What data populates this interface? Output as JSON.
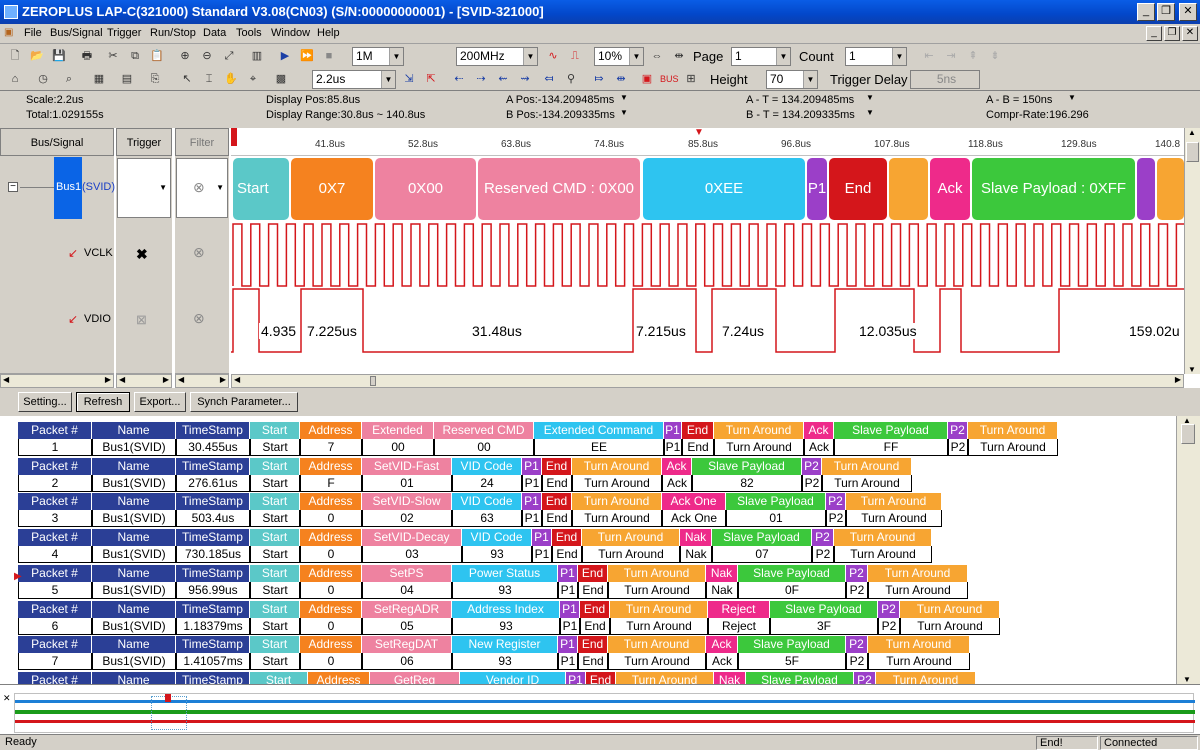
{
  "window": {
    "title": "ZEROPLUS LAP-C(321000) Standard V3.08(CN03) (S/N:00000000001) - [SVID-321000]"
  },
  "menu": [
    "File",
    "Bus/Signal",
    "Trigger",
    "Run/Stop",
    "Data",
    "Tools",
    "Window",
    "Help"
  ],
  "toolbar": {
    "memory": "1M",
    "rate": "200MHz",
    "zoom": "10%",
    "page_label": "Page",
    "page_value": "1",
    "count_label": "Count",
    "count_value": "1",
    "resolution": "2.2us",
    "height_label": "Height",
    "height_value": "70",
    "trigger_delay_label": "Trigger Delay",
    "trigger_delay_value": "5ns"
  },
  "info": {
    "scale": "Scale:2.2us",
    "total": "Total:1.029155s",
    "display_pos": "Display Pos:85.8us",
    "display_range": "Display Range:30.8us ~ 140.8us",
    "a_pos": "A Pos:-134.209485ms",
    "b_pos": "B Pos:-134.209335ms",
    "a_t": "A - T = 134.209485ms",
    "b_t": "B - T = 134.209335ms",
    "a_b": "A - B = 150ns",
    "compr": "Compr-Rate:196.296"
  },
  "wave": {
    "headers": {
      "bus": "Bus/Signal",
      "trigger": "Trigger",
      "filter": "Filter"
    },
    "bus_name": "Bus1",
    "bus_tag": "(SVID)",
    "signals": [
      "VCLK",
      "VDIO"
    ],
    "ticks": [
      "41.8us",
      "52.8us",
      "63.8us",
      "74.8us",
      "85.8us",
      "96.8us",
      "107.8us",
      "118.8us",
      "129.8us",
      "140.8"
    ],
    "segments": [
      {
        "label": "Start",
        "color": "#5bc8c8"
      },
      {
        "label": "0X7",
        "color": "#f5821f"
      },
      {
        "label": "0X00",
        "color": "#ee82a0"
      },
      {
        "label": "Reserved CMD : 0X00",
        "color": "#ee82a0"
      },
      {
        "label": "0XEE",
        "color": "#2ec4f0"
      },
      {
        "label": "P1",
        "color": "#9b3fc8"
      },
      {
        "label": "End",
        "color": "#d4161b"
      },
      {
        "label": "",
        "color": "#f7a532"
      },
      {
        "label": "Ack",
        "color": "#ee2a8a"
      },
      {
        "label": "Slave Payload : 0XFF",
        "color": "#3cc83c"
      },
      {
        "label": "",
        "color": "#9b3fc8"
      },
      {
        "label": "",
        "color": "#f7a532"
      }
    ],
    "timings": [
      "4.935",
      "7.225us",
      "31.48us",
      "7.215us",
      "7.24us",
      "12.035us",
      "159.02u"
    ]
  },
  "buttons": {
    "setting": "Setting...",
    "refresh": "Refresh",
    "export": "Export...",
    "sync": "Synch Parameter..."
  },
  "packets": [
    {
      "cells": [
        [
          "Packet #",
          "1"
        ],
        [
          "Name",
          "Bus1(SVID)"
        ],
        [
          "TimeStamp",
          "30.455us"
        ],
        [
          "Start",
          "Start"
        ],
        [
          "Address",
          "7"
        ],
        [
          "Extended",
          "00"
        ],
        [
          "Reserved CMD",
          "00"
        ],
        [
          "Extended Command",
          "EE"
        ],
        [
          "P1",
          "P1"
        ],
        [
          "End",
          "End"
        ],
        [
          "Turn Around",
          "Turn Around"
        ],
        [
          "Ack",
          "Ack"
        ],
        [
          "Slave Payload",
          "FF"
        ],
        [
          "P2",
          "P2"
        ],
        [
          "Turn Around",
          "Turn Around"
        ]
      ]
    },
    {
      "cells": [
        [
          "Packet #",
          "2"
        ],
        [
          "Name",
          "Bus1(SVID)"
        ],
        [
          "TimeStamp",
          "276.61us"
        ],
        [
          "Start",
          "Start"
        ],
        [
          "Address",
          "F"
        ],
        [
          "SetVID-Fast",
          "01"
        ],
        [
          "VID Code",
          "24"
        ],
        [
          "P1",
          "P1"
        ],
        [
          "End",
          "End"
        ],
        [
          "Turn Around",
          "Turn Around"
        ],
        [
          "Ack",
          "Ack"
        ],
        [
          "Slave Payload",
          "82"
        ],
        [
          "P2",
          "P2"
        ],
        [
          "Turn Around",
          "Turn Around"
        ]
      ]
    },
    {
      "cells": [
        [
          "Packet #",
          "3"
        ],
        [
          "Name",
          "Bus1(SVID)"
        ],
        [
          "TimeStamp",
          "503.4us"
        ],
        [
          "Start",
          "Start"
        ],
        [
          "Address",
          "0"
        ],
        [
          "SetVID-Slow",
          "02"
        ],
        [
          "VID Code",
          "63"
        ],
        [
          "P1",
          "P1"
        ],
        [
          "End",
          "End"
        ],
        [
          "Turn Around",
          "Turn Around"
        ],
        [
          "Ack One",
          "Ack One"
        ],
        [
          "Slave Payload",
          "01"
        ],
        [
          "P2",
          "P2"
        ],
        [
          "Turn Around",
          "Turn Around"
        ]
      ]
    },
    {
      "cells": [
        [
          "Packet #",
          "4"
        ],
        [
          "Name",
          "Bus1(SVID)"
        ],
        [
          "TimeStamp",
          "730.185us"
        ],
        [
          "Start",
          "Start"
        ],
        [
          "Address",
          "0"
        ],
        [
          "SetVID-Decay",
          "03"
        ],
        [
          "VID Code",
          "93"
        ],
        [
          "P1",
          "P1"
        ],
        [
          "End",
          "End"
        ],
        [
          "Turn Around",
          "Turn Around"
        ],
        [
          "Nak",
          "Nak"
        ],
        [
          "Slave Payload",
          "07"
        ],
        [
          "P2",
          "P2"
        ],
        [
          "Turn Around",
          "Turn Around"
        ]
      ]
    },
    {
      "cells": [
        [
          "Packet #",
          "5"
        ],
        [
          "Name",
          "Bus1(SVID)"
        ],
        [
          "TimeStamp",
          "956.99us"
        ],
        [
          "Start",
          "Start"
        ],
        [
          "Address",
          "0"
        ],
        [
          "SetPS",
          "04"
        ],
        [
          "Power Status",
          "93"
        ],
        [
          "P1",
          "P1"
        ],
        [
          "End",
          "End"
        ],
        [
          "Turn Around",
          "Turn Around"
        ],
        [
          "Nak",
          "Nak"
        ],
        [
          "Slave Payload",
          "0F"
        ],
        [
          "P2",
          "P2"
        ],
        [
          "Turn Around",
          "Turn Around"
        ]
      ]
    },
    {
      "cells": [
        [
          "Packet #",
          "6"
        ],
        [
          "Name",
          "Bus1(SVID)"
        ],
        [
          "TimeStamp",
          "1.18379ms"
        ],
        [
          "Start",
          "Start"
        ],
        [
          "Address",
          "0"
        ],
        [
          "SetRegADR",
          "05"
        ],
        [
          "Address Index",
          "93"
        ],
        [
          "P1",
          "P1"
        ],
        [
          "End",
          "End"
        ],
        [
          "Turn Around",
          "Turn Around"
        ],
        [
          "Reject",
          "Reject"
        ],
        [
          "Slave Payload",
          "3F"
        ],
        [
          "P2",
          "P2"
        ],
        [
          "Turn Around",
          "Turn Around"
        ]
      ]
    },
    {
      "cells": [
        [
          "Packet #",
          "7"
        ],
        [
          "Name",
          "Bus1(SVID)"
        ],
        [
          "TimeStamp",
          "1.41057ms"
        ],
        [
          "Start",
          "Start"
        ],
        [
          "Address",
          "0"
        ],
        [
          "SetRegDAT",
          "06"
        ],
        [
          "New Register",
          "93"
        ],
        [
          "P1",
          "P1"
        ],
        [
          "End",
          "End"
        ],
        [
          "Turn Around",
          "Turn Around"
        ],
        [
          "Ack",
          "Ack"
        ],
        [
          "Slave Payload",
          "5F"
        ],
        [
          "P2",
          "P2"
        ],
        [
          "Turn Around",
          "Turn Around"
        ]
      ]
    },
    {
      "cells": [
        [
          "Packet #",
          ""
        ],
        [
          "Name",
          ""
        ],
        [
          "TimeStamp",
          ""
        ],
        [
          "Start",
          ""
        ],
        [
          "Address",
          ""
        ],
        [
          "GetReg",
          ""
        ],
        [
          "Vendor ID",
          ""
        ],
        [
          "P1",
          ""
        ],
        [
          "End",
          ""
        ],
        [
          "Turn Around",
          ""
        ],
        [
          "Nak",
          ""
        ],
        [
          "Slave Payload",
          ""
        ],
        [
          "P2",
          ""
        ],
        [
          "Turn Around",
          ""
        ]
      ]
    }
  ],
  "status": {
    "ready": "Ready",
    "end": "End!",
    "connected": "Connected"
  }
}
